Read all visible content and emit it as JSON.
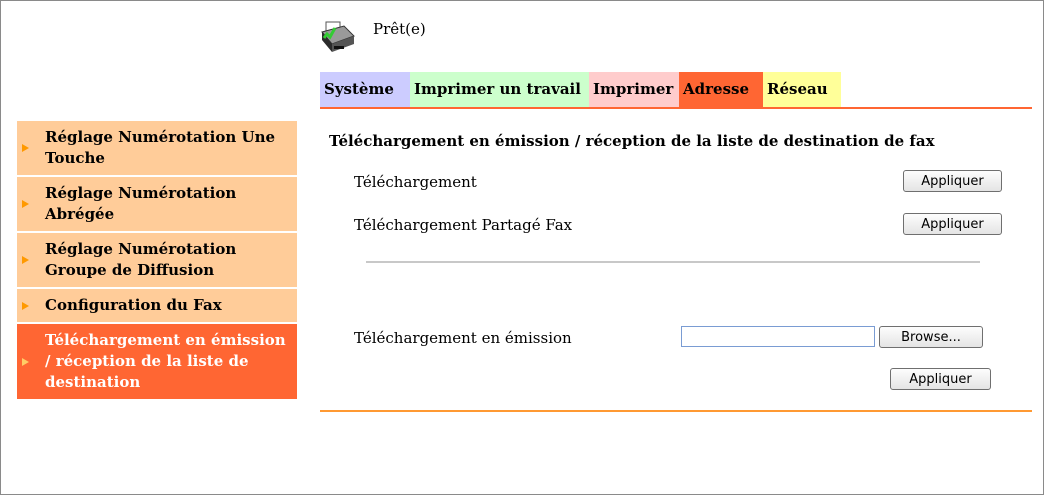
{
  "status": {
    "text": "Prêt(e)",
    "icon": "printer-icon"
  },
  "tabs": [
    {
      "label": "Système",
      "color": "#ccccff"
    },
    {
      "label": "Imprimer un travail",
      "color": "#ccffcc"
    },
    {
      "label": "Imprimer",
      "color": "#ffcccc"
    },
    {
      "label": "Adresse",
      "color": "#ff6633",
      "active": true
    },
    {
      "label": "Réseau",
      "color": "#ffff99"
    }
  ],
  "sidebar": {
    "items": [
      {
        "label": "Réglage Numérotation Une Touche"
      },
      {
        "label": "Réglage Numérotation Abrégée"
      },
      {
        "label": "Réglage Numérotation Groupe de Diffusion"
      },
      {
        "label": "Configuration du Fax"
      },
      {
        "label": "Téléchargement en émission / réception de la liste de destination",
        "active": true
      }
    ]
  },
  "main": {
    "title": "Téléchargement en émission / réception de la liste de destination de fax",
    "download_label": "Téléchargement",
    "shared_download_label": "Téléchargement Partagé Fax",
    "upload_label": "Téléchargement en émission",
    "apply_label": "Appliquer",
    "browse_label": "Browse...",
    "file_value": ""
  },
  "colors": {
    "accent": "#ff6633",
    "sidebar_bg": "#ffcc99",
    "bottom_line": "#ff9933"
  }
}
